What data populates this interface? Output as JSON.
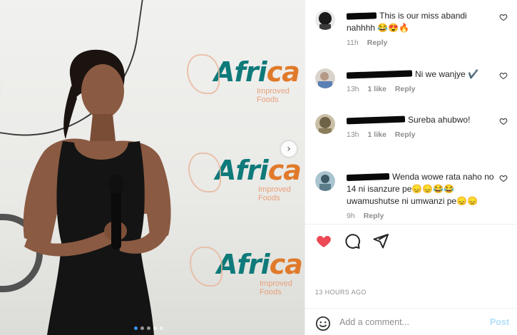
{
  "photo": {
    "logo_word": "Afri",
    "logo_word_accent": "ca",
    "logo_sub": "Improved Foods",
    "next_icon": "chevron-right-icon",
    "slides": 5,
    "active_slide": 1
  },
  "comments": [
    {
      "text": "This is our miss abandi nahhhh 😂😍🔥",
      "time": "11h",
      "likes": "",
      "reply": "Reply",
      "avatar_colors": [
        "#1a1a1a",
        "#3b3b3b"
      ]
    },
    {
      "text": "Ni we wanjye ✔️",
      "time": "13h",
      "likes": "1 like",
      "reply": "Reply",
      "avatar_colors": [
        "#c9c0b6",
        "#5a7fb5"
      ]
    },
    {
      "text": "Sureba ahubwo!",
      "time": "13h",
      "likes": "1 like",
      "reply": "Reply",
      "avatar_colors": [
        "#b7a98c",
        "#6e6346"
      ]
    },
    {
      "text": "Wenda wowe rata naho no 14 ni isanzure pe😞😞😂😂 uwamushutse ni umwanzi pe😞😞",
      "time": "9h",
      "likes": "",
      "reply": "Reply",
      "avatar_colors": [
        "#7fa3b3",
        "#3e5a66"
      ]
    }
  ],
  "actions": {
    "like_icon": "heart-filled-icon",
    "comment_icon": "comment-icon",
    "share_icon": "paper-plane-icon"
  },
  "time_ago": "13 HOURS AGO",
  "add_comment": {
    "placeholder": "Add a comment...",
    "post_label": "Post",
    "emoji_icon": "emoji-icon"
  },
  "colors": {
    "like_red": "#ed4956",
    "post_disabled": "#b2dffc",
    "muted": "#8e8e8e",
    "brand_teal": "#0f7a7a"
  }
}
